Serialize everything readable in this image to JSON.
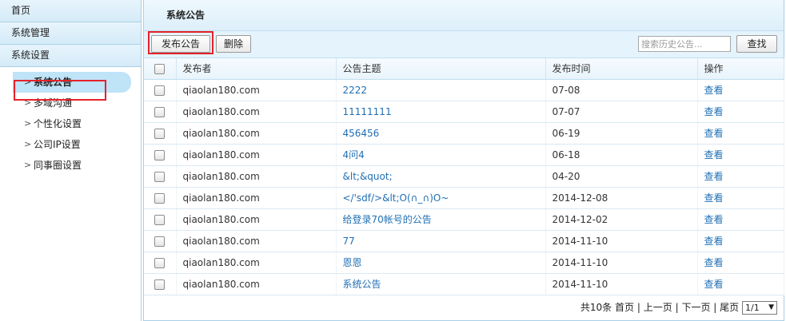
{
  "sidebar": {
    "sections": [
      "首页",
      "系统管理",
      "系统设置"
    ],
    "sub_items": [
      "系统公告",
      "多域沟通",
      "个性化设置",
      "公司IP设置",
      "同事圈设置"
    ]
  },
  "main": {
    "title": "系统公告",
    "toolbar": {
      "publish_label": "发布公告",
      "delete_label": "删除",
      "search_placeholder": "搜索历史公告...",
      "search_label": "查找"
    },
    "table": {
      "headers": [
        "发布者",
        "公告主题",
        "发布时间",
        "操作"
      ],
      "rows": [
        {
          "publisher": "qiaolan180.com",
          "subject": "2222",
          "time": "07-08",
          "action": "查看"
        },
        {
          "publisher": "qiaolan180.com",
          "subject": "11111111",
          "time": "07-07",
          "action": "查看"
        },
        {
          "publisher": "qiaolan180.com",
          "subject": "456456",
          "time": "06-19",
          "action": "查看"
        },
        {
          "publisher": "qiaolan180.com",
          "subject": "4问4",
          "time": "06-18",
          "action": "查看"
        },
        {
          "publisher": "qiaolan180.com",
          "subject": "&lt;&quot;",
          "time": "04-20",
          "action": "查看"
        },
        {
          "publisher": "qiaolan180.com",
          "subject": "</'sdf/>&lt;O(∩_∩)O~",
          "time": "2014-12-08",
          "action": "查看"
        },
        {
          "publisher": "qiaolan180.com",
          "subject": "给登录70帐号的公告",
          "time": "2014-12-02",
          "action": "查看"
        },
        {
          "publisher": "qiaolan180.com",
          "subject": "77",
          "time": "2014-11-10",
          "action": "查看"
        },
        {
          "publisher": "qiaolan180.com",
          "subject": "恩恩",
          "time": "2014-11-10",
          "action": "查看"
        },
        {
          "publisher": "qiaolan180.com",
          "subject": "系统公告",
          "time": "2014-11-10",
          "action": "查看"
        }
      ]
    },
    "pager": {
      "total": "共10条",
      "first": "首页",
      "prev": "上一页",
      "next": "下一页",
      "last": "尾页",
      "sep": "|",
      "page_select": "1/1"
    }
  },
  "colors": {
    "accent_link": "#1f6fb4",
    "highlight_box": "#e4222b",
    "active_nav_bg": "#bfe3f7"
  }
}
